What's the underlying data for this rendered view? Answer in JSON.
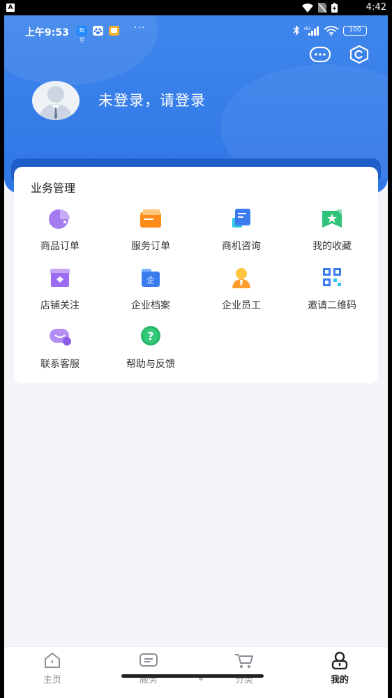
{
  "system_bar": {
    "time": "4:42",
    "left_icon": "A"
  },
  "inner_status": {
    "time": "上午9:53",
    "battery": "100",
    "dots": "···",
    "badge1": "知乎"
  },
  "header": {
    "login_prompt": "未登录，请登录"
  },
  "business": {
    "title": "业务管理",
    "items": [
      {
        "label": "商品订单",
        "icon": "pie-chart-icon"
      },
      {
        "label": "服务订单",
        "icon": "folder-icon"
      },
      {
        "label": "商机咨询",
        "icon": "document-icon"
      },
      {
        "label": "我的收藏",
        "icon": "favorite-star-icon"
      },
      {
        "label": "店铺关注",
        "icon": "store-icon"
      },
      {
        "label": "企业档案",
        "icon": "enterprise-folder-icon"
      },
      {
        "label": "企业员工",
        "icon": "employee-icon"
      },
      {
        "label": "邀请二维码",
        "icon": "qr-code-icon"
      },
      {
        "label": "联系客服",
        "icon": "chat-bubble-icon"
      },
      {
        "label": "帮助与反馈",
        "icon": "help-question-icon"
      }
    ]
  },
  "tabbar": {
    "tabs": [
      {
        "label": "主页",
        "icon": "home-icon",
        "active": false
      },
      {
        "label": "服务",
        "icon": "service-icon",
        "active": false
      },
      {
        "label": "分类",
        "icon": "cart-icon",
        "active": false
      },
      {
        "label": "我的",
        "icon": "profile-icon",
        "active": true
      }
    ]
  },
  "colors": {
    "header_blue": "#3f86ec",
    "active_tab_text": "#222222",
    "inactive_tab_text": "#8a8e96"
  }
}
